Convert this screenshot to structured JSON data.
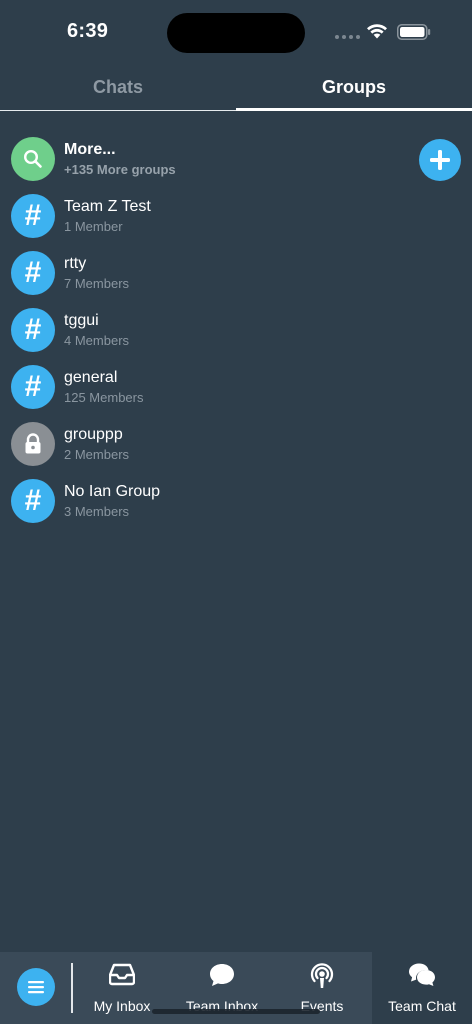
{
  "status_bar": {
    "time": "6:39"
  },
  "tabs": [
    {
      "label": "Chats",
      "active": false
    },
    {
      "label": "Groups",
      "active": true
    }
  ],
  "more": {
    "title": "More...",
    "subtitle": "+135 More groups",
    "icon": "search-icon"
  },
  "groups": [
    {
      "name": "Team Z Test",
      "members": "1 Member",
      "icon": "hash-icon"
    },
    {
      "name": "rtty",
      "members": "7 Members",
      "icon": "hash-icon"
    },
    {
      "name": "tggui",
      "members": "4 Members",
      "icon": "hash-icon"
    },
    {
      "name": "general",
      "members": "125 Members",
      "icon": "hash-icon"
    },
    {
      "name": "grouppp",
      "members": "2 Members",
      "icon": "lock-icon"
    },
    {
      "name": "No Ian Group",
      "members": "3 Members",
      "icon": "hash-icon"
    }
  ],
  "bottom_nav": {
    "items": [
      {
        "label": "My Inbox",
        "icon": "inbox-tray-icon"
      },
      {
        "label": "Team Inbox",
        "icon": "chat-bubble-icon"
      },
      {
        "label": "Events",
        "icon": "broadcast-icon"
      },
      {
        "label": "Team Chat",
        "icon": "chat-bubbles-icon",
        "active": true
      }
    ]
  },
  "colors": {
    "background": "#2e3e4b",
    "accent": "#3db2f0",
    "search_green": "#6fcf8b",
    "lock_gray": "#8a8f94",
    "nav_background": "#3a4a58"
  }
}
